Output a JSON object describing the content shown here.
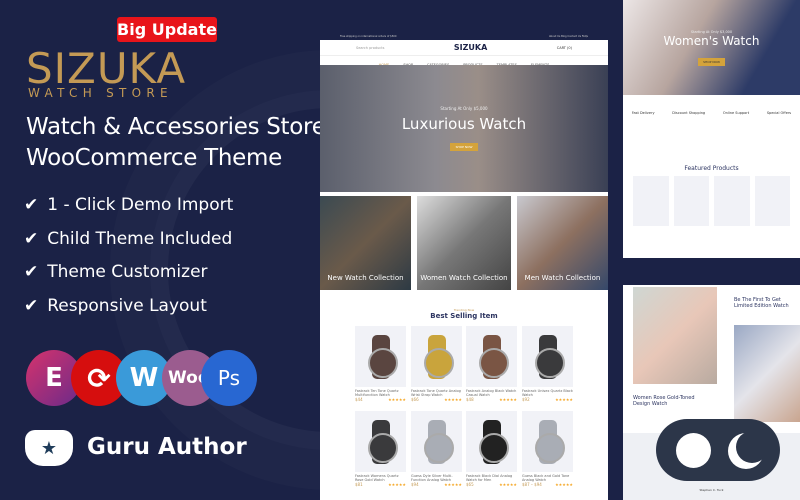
{
  "badge": "Big Update",
  "brand": {
    "name": "SIZUKA",
    "tagline": "WATCH STORE"
  },
  "headline": [
    "Watch & Accessories Store",
    "WooCommerce Theme"
  ],
  "features": [
    "1 - Click Demo Import",
    "Child Theme Included",
    "Theme Customizer",
    "Responsive Layout"
  ],
  "plugins": [
    {
      "icon": "elementor-icon",
      "label": "E",
      "color": "#a8336e"
    },
    {
      "icon": "revolution-slider-icon",
      "label": "⟳",
      "color": "#d60e0e"
    },
    {
      "icon": "wordpress-icon",
      "label": "W",
      "color": "#3a9ad9"
    },
    {
      "icon": "woocommerce-icon",
      "label": "Woo",
      "color": "#9b5c8f"
    },
    {
      "icon": "photoshop-icon",
      "label": "Ps",
      "color": "#2867d2"
    }
  ],
  "author": "Guru Author",
  "colors": {
    "background": "#1b2246",
    "gold": "#c49a55",
    "badge": "#e8141a"
  },
  "preview": {
    "topbar": "Free shipping on international orders of $500",
    "toplinks": [
      "About Us",
      "Blog",
      "Contact Us",
      "FAQs"
    ],
    "search_placeholder": "Search products",
    "logo": "SIZUKA",
    "logo_sub": "WATCH STORE",
    "cart": "CART (0)",
    "nav": [
      "HOME",
      "SHOP",
      "CATEGORIES",
      "PRODUCTS",
      "TEMPLATES",
      "ELEMENTS"
    ],
    "hero": {
      "kicker": "Starting At Only $5,000",
      "title": "Luxurious Watch",
      "button": "SHOP NOW"
    },
    "collections": [
      "New Watch Collection",
      "Women Watch Collection",
      "Men Watch Collection"
    ],
    "best": {
      "kicker": "Trending Now",
      "title": "Best Selling Item",
      "products": [
        {
          "title": "Fastrack Ten Tone Quartz Multifunction Watch",
          "price": "$44"
        },
        {
          "title": "Fastrack Tone Quartz Analog Wrist Strap Watch",
          "price": "$66"
        },
        {
          "title": "Fastrack Analog Black Watch Casual Watch",
          "price": "$48"
        },
        {
          "title": "Fastrack Unisex Quartz Black Watch",
          "price": "$92"
        },
        {
          "title": "Fastrack Womens Quartz Rose Gold Watch",
          "price": "$81"
        },
        {
          "title": "Guess Dyle Silver Multi-Function Analog Watch",
          "price": "$94"
        },
        {
          "title": "Fastrack Black Dial Analog Watch for Men",
          "price": "$65"
        },
        {
          "title": "Guess Black and Gold Tone Analog Watch",
          "price": "$87 – $94"
        }
      ]
    }
  },
  "preview2": {
    "hero": {
      "kicker": "Starting At Only $3,000",
      "title": "Women's Watch",
      "button": "SHOP NOW"
    },
    "services": [
      "Fast Delivery",
      "Discount Shopping",
      "Online Support",
      "Special Offers"
    ],
    "featured": {
      "kicker": "Trending Now",
      "title": "Featured Products"
    },
    "promo1": "Women Rose Gold-Toned Design Watch",
    "promo2": "Be The First To Get Limited Edition Watch",
    "testimonial": "Stephen C. Tuck"
  }
}
